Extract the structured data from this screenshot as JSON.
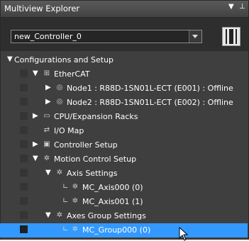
{
  "window": {
    "title": "Multiview Explorer",
    "pin_glyph": "▾ ⊥",
    "controller_select": {
      "value": "new_Controller_0"
    }
  },
  "tree": [
    {
      "label": "Configurations and Setup",
      "expander": "▼",
      "icon": ""
    },
    {
      "label": "EtherCAT",
      "expander": "▼",
      "icon": "network-icon",
      "glyph": "⊞"
    },
    {
      "label": "Node1 : R88D-1SN01L-ECT (E001) : Offline",
      "expander": "▶",
      "icon": "node-icon",
      "glyph": "◎"
    },
    {
      "label": "Node2 : R88D-1SN01L-ECT (E002) : Offline",
      "expander": "▶",
      "icon": "node-icon",
      "glyph": "◎"
    },
    {
      "label": "CPU/Expansion Racks",
      "expander": "▶",
      "icon": "rack-icon",
      "glyph": "▭"
    },
    {
      "label": "I/O Map",
      "expander": "",
      "icon": "io-map-icon",
      "glyph": "⇄"
    },
    {
      "label": "Controller Setup",
      "expander": "▶",
      "icon": "controller-icon",
      "glyph": "▣"
    },
    {
      "label": "Motion Control Setup",
      "expander": "▼",
      "icon": "motion-icon",
      "glyph": "✲"
    },
    {
      "label": "Axis Settings",
      "expander": "▼",
      "icon": "axis-settings-icon",
      "glyph": "✲"
    },
    {
      "label": "MC_Axis000 (0)",
      "expander": "",
      "icon": "axis-icon",
      "glyph": "✲"
    },
    {
      "label": "MC_Axis001 (1)",
      "expander": "",
      "icon": "axis-icon",
      "glyph": "✲"
    },
    {
      "label": "Axes Group Settings",
      "expander": "▼",
      "icon": "axes-group-icon",
      "glyph": "✲"
    },
    {
      "label": "MC_Group000 (0)",
      "expander": "",
      "icon": "group-icon",
      "glyph": "✲",
      "selected": true
    }
  ]
}
